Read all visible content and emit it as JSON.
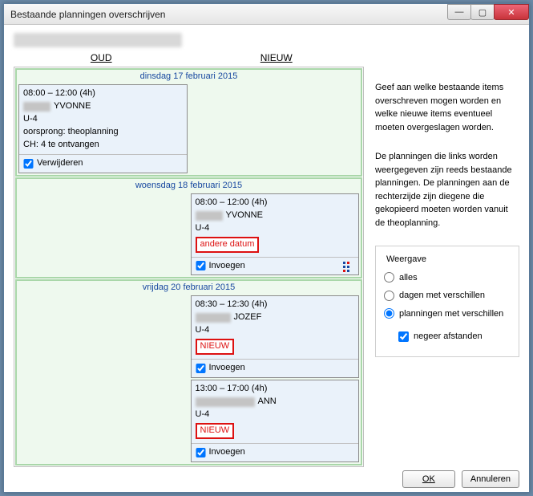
{
  "window": {
    "title": "Bestaande planningen overschrijven"
  },
  "columns": {
    "old": "OUD",
    "new": "NIEUW"
  },
  "days": [
    {
      "label": "dinsdag 17 februari 2015",
      "old": {
        "time": "08:00 – 12:00   (4h)",
        "name": "YVONNE",
        "room": "U-4",
        "origin": "oorsprong: theoplanning",
        "ch": "CH: 4 te ontvangen",
        "check_label": "Verwijderen",
        "checked": true
      },
      "new": null
    },
    {
      "label": "woensdag 18 februari 2015",
      "old": null,
      "new": {
        "time": "08:00 – 12:00   (4h)",
        "name": "YVONNE",
        "room": "U-4",
        "badge": "andere datum",
        "check_label": "Invoegen",
        "checked": true,
        "icon": true
      }
    },
    {
      "label": "vrijdag 20 februari 2015",
      "old": null,
      "newA": {
        "time": "08:30 – 12:30   (4h)",
        "name": "JOZEF",
        "room": "U-4",
        "badge": "NIEUW",
        "check_label": "Invoegen",
        "checked": true
      },
      "newB": {
        "time": "13:00 – 17:00   (4h)",
        "name": "ANN",
        "room": "U-4",
        "badge": "NIEUW",
        "check_label": "Invoegen",
        "checked": true
      }
    }
  ],
  "info": {
    "p1": "Geef aan welke bestaande items overschreven mogen worden en welke nieuwe items eventueel moeten overgeslagen worden.",
    "p2": "De planningen die links worden weergegeven zijn reeds bestaande planningen. De planningen aan de rechterzijde zijn diegene die gekopieerd moeten worden vanuit de theoplanning."
  },
  "weergave": {
    "legend": "Weergave",
    "r1": "alles",
    "r2": "dagen met verschillen",
    "r3": "planningen met verschillen",
    "c1": "negeer afstanden"
  },
  "buttons": {
    "ok": "OK",
    "cancel": "Annuleren"
  }
}
